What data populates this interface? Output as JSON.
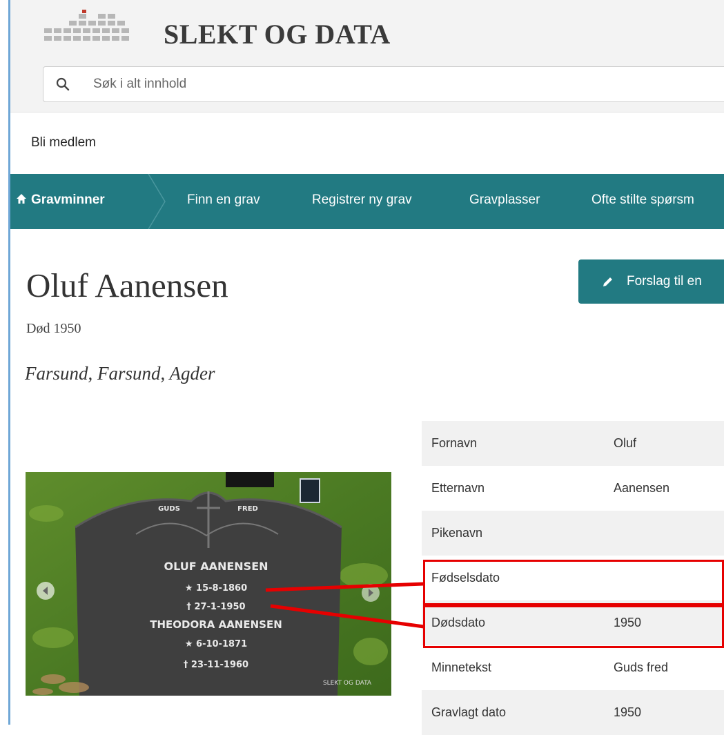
{
  "header": {
    "site_name": "SLEKT OG DATA",
    "logo_icon": "grid-logo-icon"
  },
  "search": {
    "placeholder": "Søk i alt innhold",
    "value": ""
  },
  "member_link": "Bli medlem",
  "nav": {
    "home": "Gravminner",
    "items": [
      "Finn en grav",
      "Registrer ny grav",
      "Gravplasser",
      "Ofte stilte spørsm"
    ]
  },
  "person": {
    "name": "Oluf Aanensen",
    "death_line": "Død 1950",
    "location": "Farsund, Farsund, Agder"
  },
  "suggest_button": "Forslag til en",
  "details": [
    {
      "label": "Fornavn",
      "value": "Oluf"
    },
    {
      "label": "Etternavn",
      "value": "Aanensen"
    },
    {
      "label": "Pikenavn",
      "value": ""
    },
    {
      "label": "Fødselsdato",
      "value": ""
    },
    {
      "label": "Dødsdato",
      "value": "1950"
    },
    {
      "label": "Minnetekst",
      "value": "Guds fred"
    },
    {
      "label": "Gravlagt dato",
      "value": "1950"
    }
  ],
  "gravestone": {
    "top_left": "GUDS",
    "top_right": "FRED",
    "lines": [
      "OLUF AANENSEN",
      "★ 15-8-1860",
      "† 27-1-1950",
      "THEODORA AANENSEN",
      "★ 6-10-1871",
      "† 23-11-1960"
    ],
    "watermark": "SLEKT OG DATA"
  },
  "colors": {
    "accent_teal": "#227a82",
    "highlight_red": "#e60000",
    "masthead_bg": "#f3f3f3"
  }
}
